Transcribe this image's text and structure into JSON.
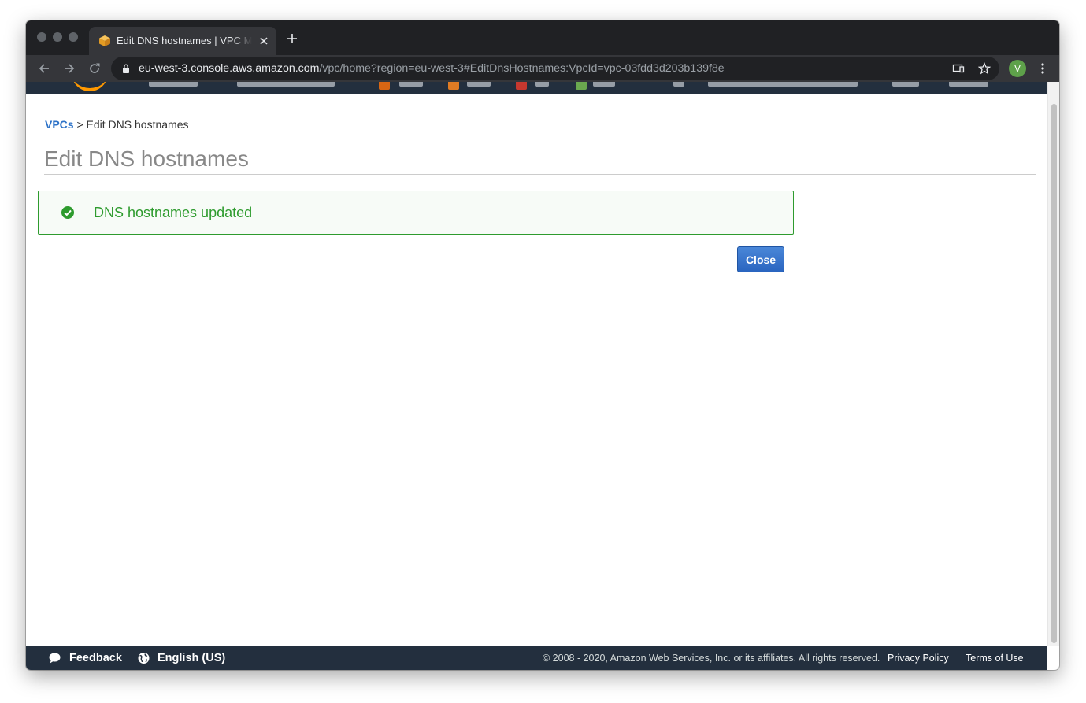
{
  "browser": {
    "tab": {
      "title": "Edit DNS hostnames | VPC Management Console"
    },
    "address_bar": {
      "host": "eu-west-3.console.aws.amazon.com",
      "path": "/vpc/home?region=eu-west-3#EditDnsHostnames:VpcId=vpc-03fdd3d203b139f8e"
    },
    "profile_initial": "V"
  },
  "breadcrumb": {
    "root_label": "VPCs",
    "separator": ">",
    "current_label": "Edit DNS hostnames"
  },
  "page": {
    "title": "Edit DNS hostnames",
    "alert": {
      "type": "success",
      "message": "DNS hostnames updated",
      "color": "#2e9b2e"
    },
    "close_button_label": "Close"
  },
  "footer": {
    "feedback_label": "Feedback",
    "language_label": "English (US)",
    "copyright": "© 2008 - 2020, Amazon Web Services, Inc. or its affiliates. All rights reserved.",
    "privacy_label": "Privacy Policy",
    "terms_label": "Terms of Use"
  },
  "colors": {
    "aws_nav": "#232f3e",
    "accent_orange": "#ff9900",
    "link_blue": "#2e73c8",
    "primary_button": "#2a65c0"
  },
  "icons": [
    "aws-box-icon",
    "close-icon",
    "plus-icon",
    "back-icon",
    "forward-icon",
    "reload-icon",
    "lock-icon",
    "cast-icon",
    "star-icon",
    "kebab-menu-icon",
    "success-check-icon",
    "feedback-bubble-icon",
    "globe-icon"
  ]
}
